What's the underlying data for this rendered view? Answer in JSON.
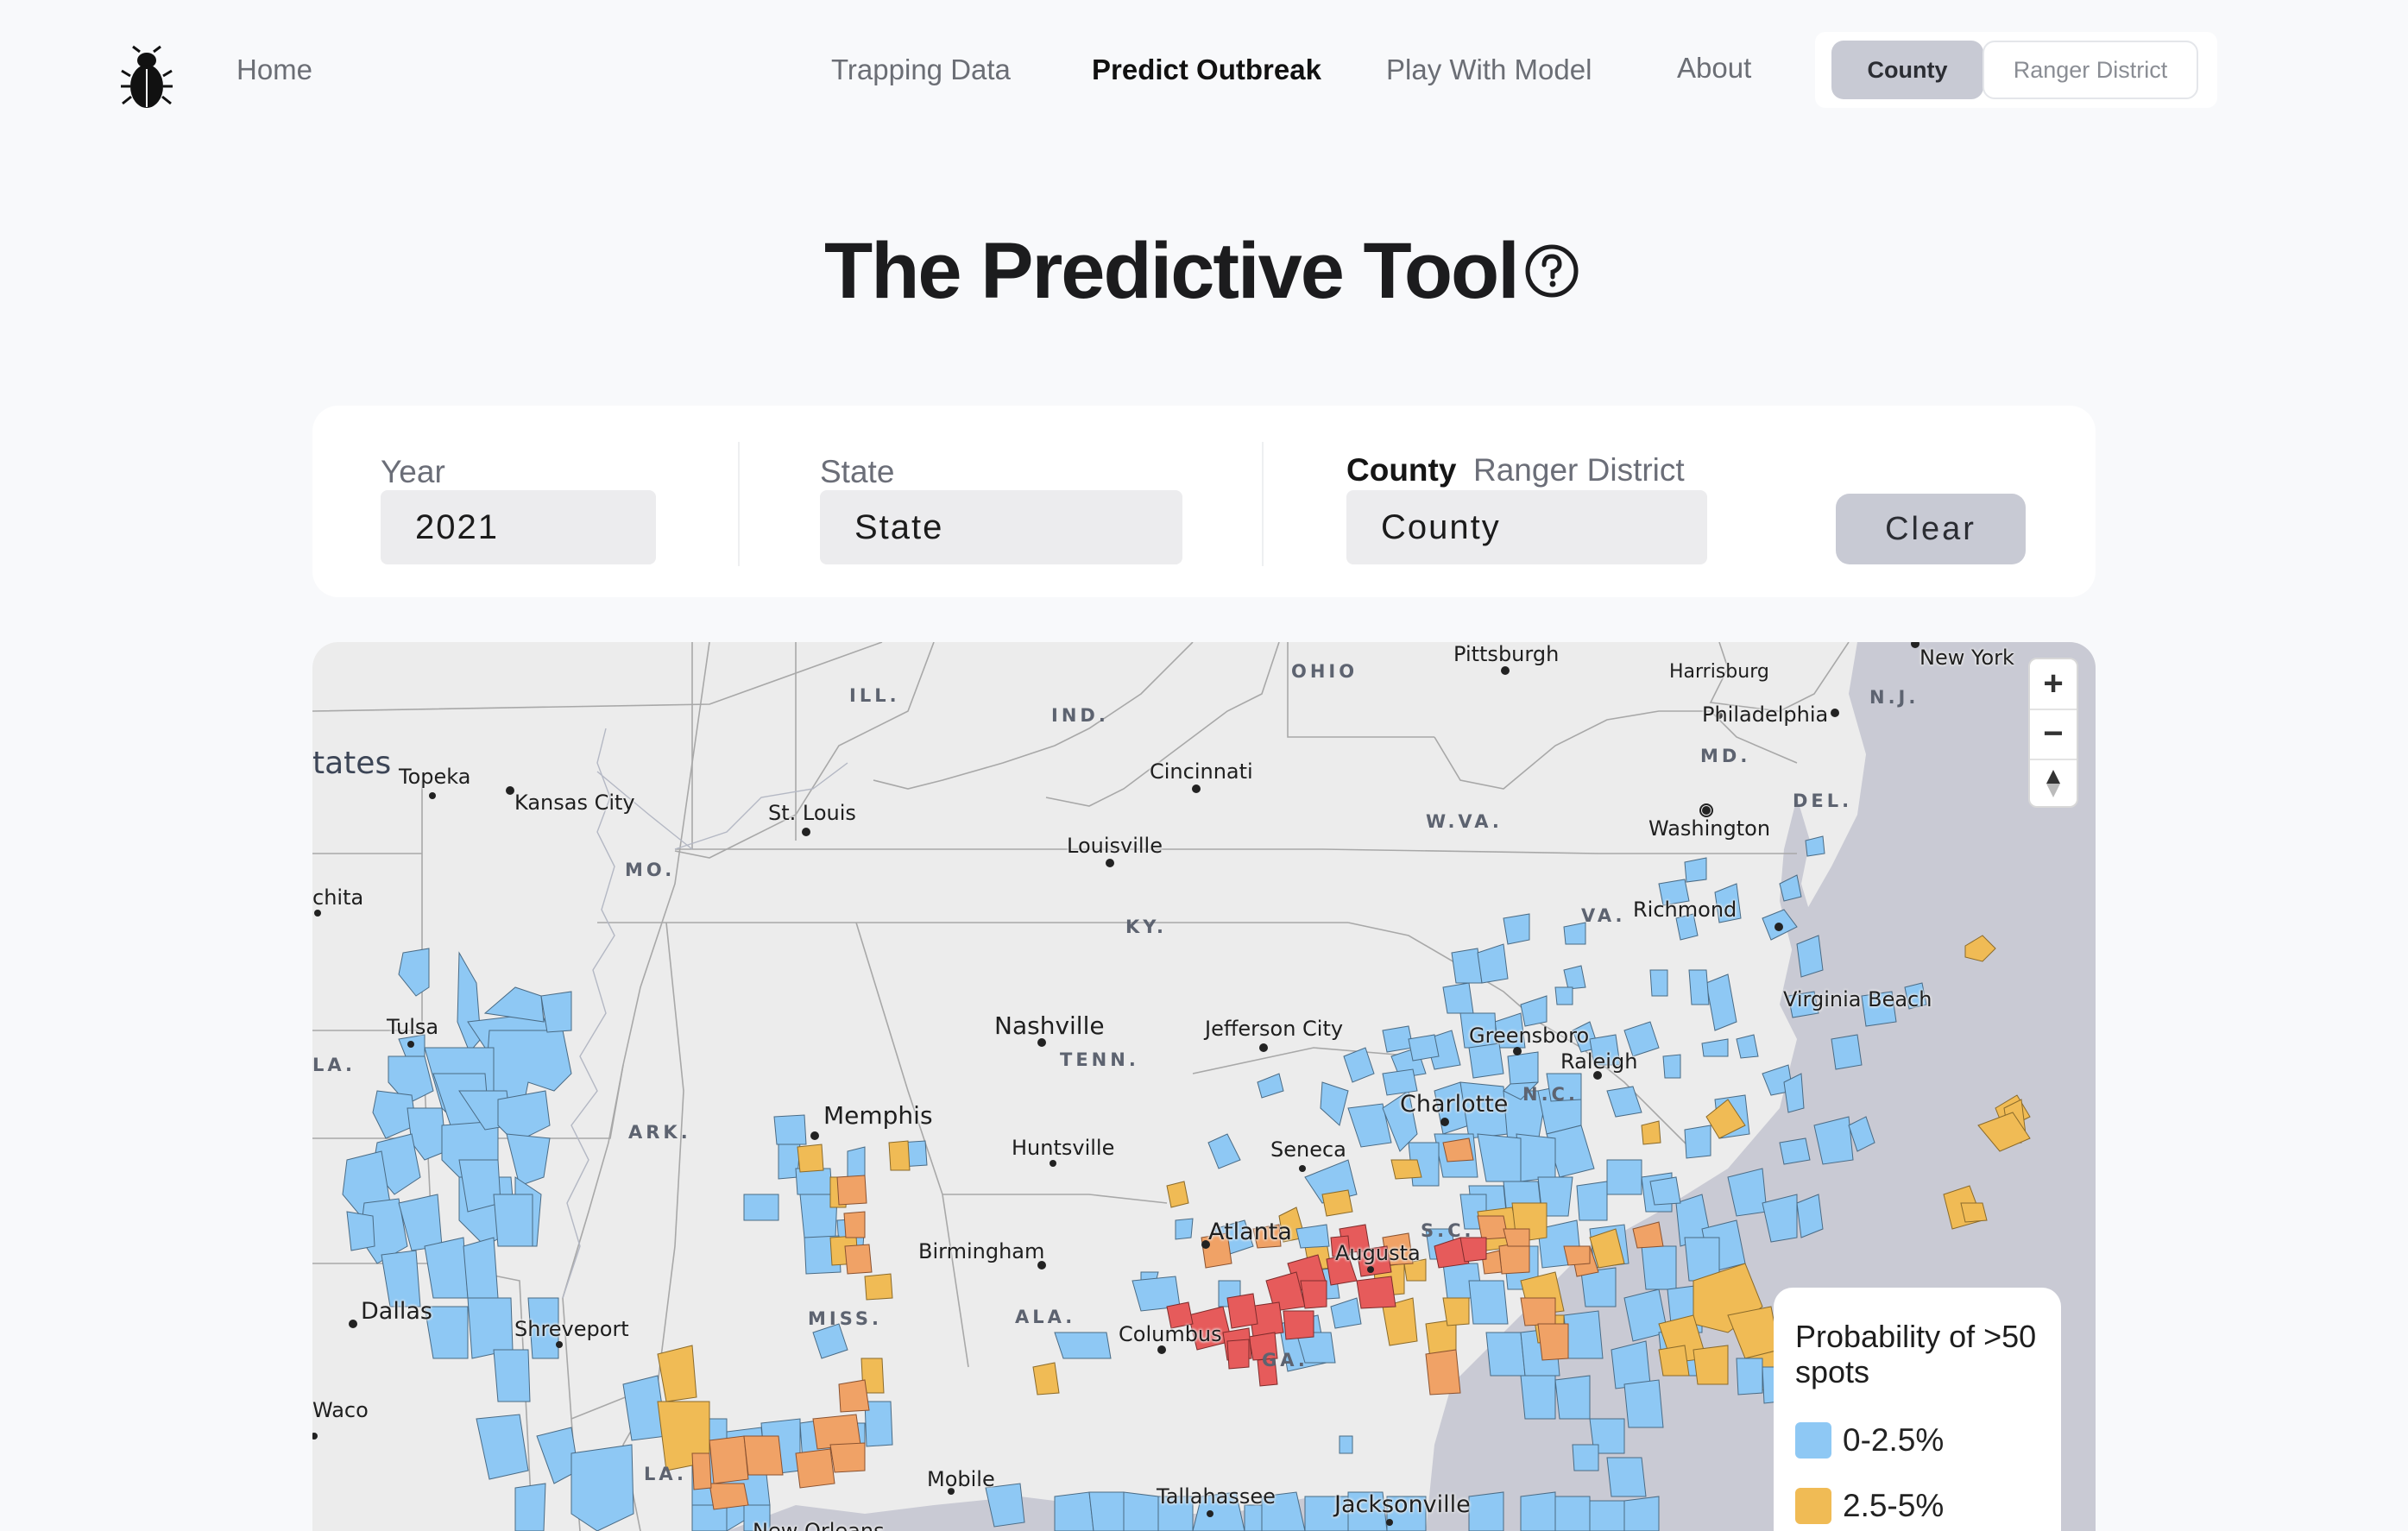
{
  "nav": {
    "home": "Home",
    "links": [
      "Trapping Data",
      "Predict Outbreak",
      "Play With Model",
      "About"
    ],
    "active": "Predict Outbreak",
    "toggle": {
      "selected": "County",
      "other": "Ranger District"
    }
  },
  "page": {
    "title": "The Predictive Tool"
  },
  "filters": {
    "year_label": "Year",
    "year_value": "2021",
    "state_label": "State",
    "state_value": "State",
    "county_label": "County",
    "ranger_label": "Ranger District",
    "county_value": "County",
    "clear_label": "Clear"
  },
  "map": {
    "labels": {
      "states_partial": "tates",
      "ill": "ILL.",
      "ind": "IND.",
      "ohio": "OHIO",
      "mo": "MO.",
      "ky": "KY.",
      "wva": "W.VA.",
      "va": "VA.",
      "md": "MD.",
      "del": "DEL.",
      "nj": "N.J.",
      "tenn": "TENN.",
      "nc": "N.C.",
      "sc": "S.C.",
      "ga": "GA.",
      "ala": "ALA.",
      "miss": "MISS.",
      "ark": "ARK.",
      "la": "LA.",
      "la2": "LA."
    },
    "cities": {
      "pittsburgh": "Pittsburgh",
      "new_york": "New York",
      "harrisburg": "Harrisburg",
      "philadelphia": "Philadelphia",
      "washington": "Washington",
      "richmond": "Richmond",
      "virginia_beach": "Virginia Beach",
      "topeka": "Topeka",
      "kansas_city": "Kansas City",
      "st_louis": "St. Louis",
      "cincinnati": "Cincinnati",
      "louisville": "Louisville",
      "wichita": "chita",
      "tulsa": "Tulsa",
      "nashville": "Nashville",
      "jefferson_city": "Jefferson City",
      "greensboro": "Greensboro",
      "raleigh": "Raleigh",
      "charlotte": "Charlotte",
      "memphis": "Memphis",
      "huntsville": "Huntsville",
      "seneca": "Seneca",
      "atlanta": "Atlanta",
      "augusta": "Augusta",
      "birmingham": "Birmingham",
      "dallas": "Dallas",
      "shreveport": "Shreveport",
      "columbus": "Columbus",
      "waco": "Waco",
      "mobile": "Mobile",
      "tallahassee": "Tallahassee",
      "jacksonville": "Jacksonville",
      "new_orleans": "New Orleans"
    },
    "zoom_in": "+",
    "zoom_out": "−"
  },
  "legend": {
    "title": "Probability of >50 spots",
    "items": [
      {
        "label": "0-2.5%",
        "color": "#8ec8f4"
      },
      {
        "label": "2.5-5%",
        "color": "#f0bb55"
      }
    ]
  },
  "colors": {
    "low": "#8ec8f4",
    "mid": "#f0bb55",
    "high": "#f0a266",
    "veryhigh": "#e65b5b",
    "water": "#c9cad4",
    "land": "#ececec"
  }
}
